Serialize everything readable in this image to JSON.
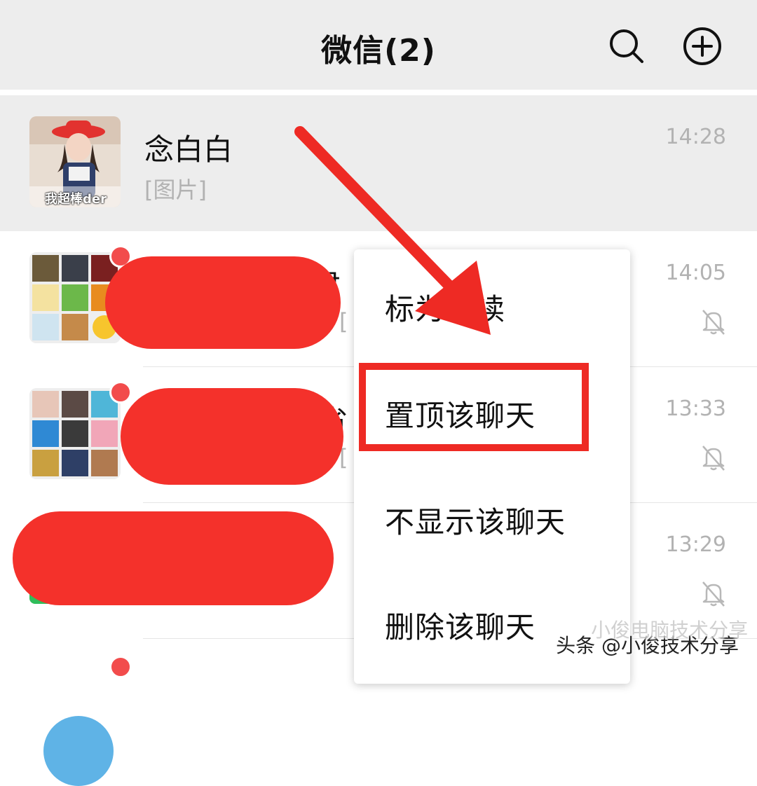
{
  "header": {
    "title": "微信(2)"
  },
  "chats": [
    {
      "name": "念白白",
      "preview": "[图片]",
      "time": "14:28",
      "pinned": true,
      "avatar_caption": "我超棒der"
    },
    {
      "name_partial": "君",
      "preview_partial": "[",
      "time": "14:05",
      "muted": true,
      "unread": true
    },
    {
      "name_partial": "省",
      "preview_partial": "[",
      "time": "13:33",
      "muted": true,
      "unread": true
    },
    {
      "time": "13:29",
      "muted": true
    }
  ],
  "context_menu": {
    "items": [
      "标为未读",
      "置顶该聊天",
      "不显示该聊天",
      "删除该聊天"
    ],
    "highlighted_item": "置顶该聊天"
  },
  "watermark": {
    "text": "头条 @小俊技术分享",
    "faint_text": "小俊电脑技术分享"
  },
  "colors": {
    "annotation_red": "#ee2a24",
    "badge_red": "#f24c4c",
    "header_bg": "#ededed"
  }
}
